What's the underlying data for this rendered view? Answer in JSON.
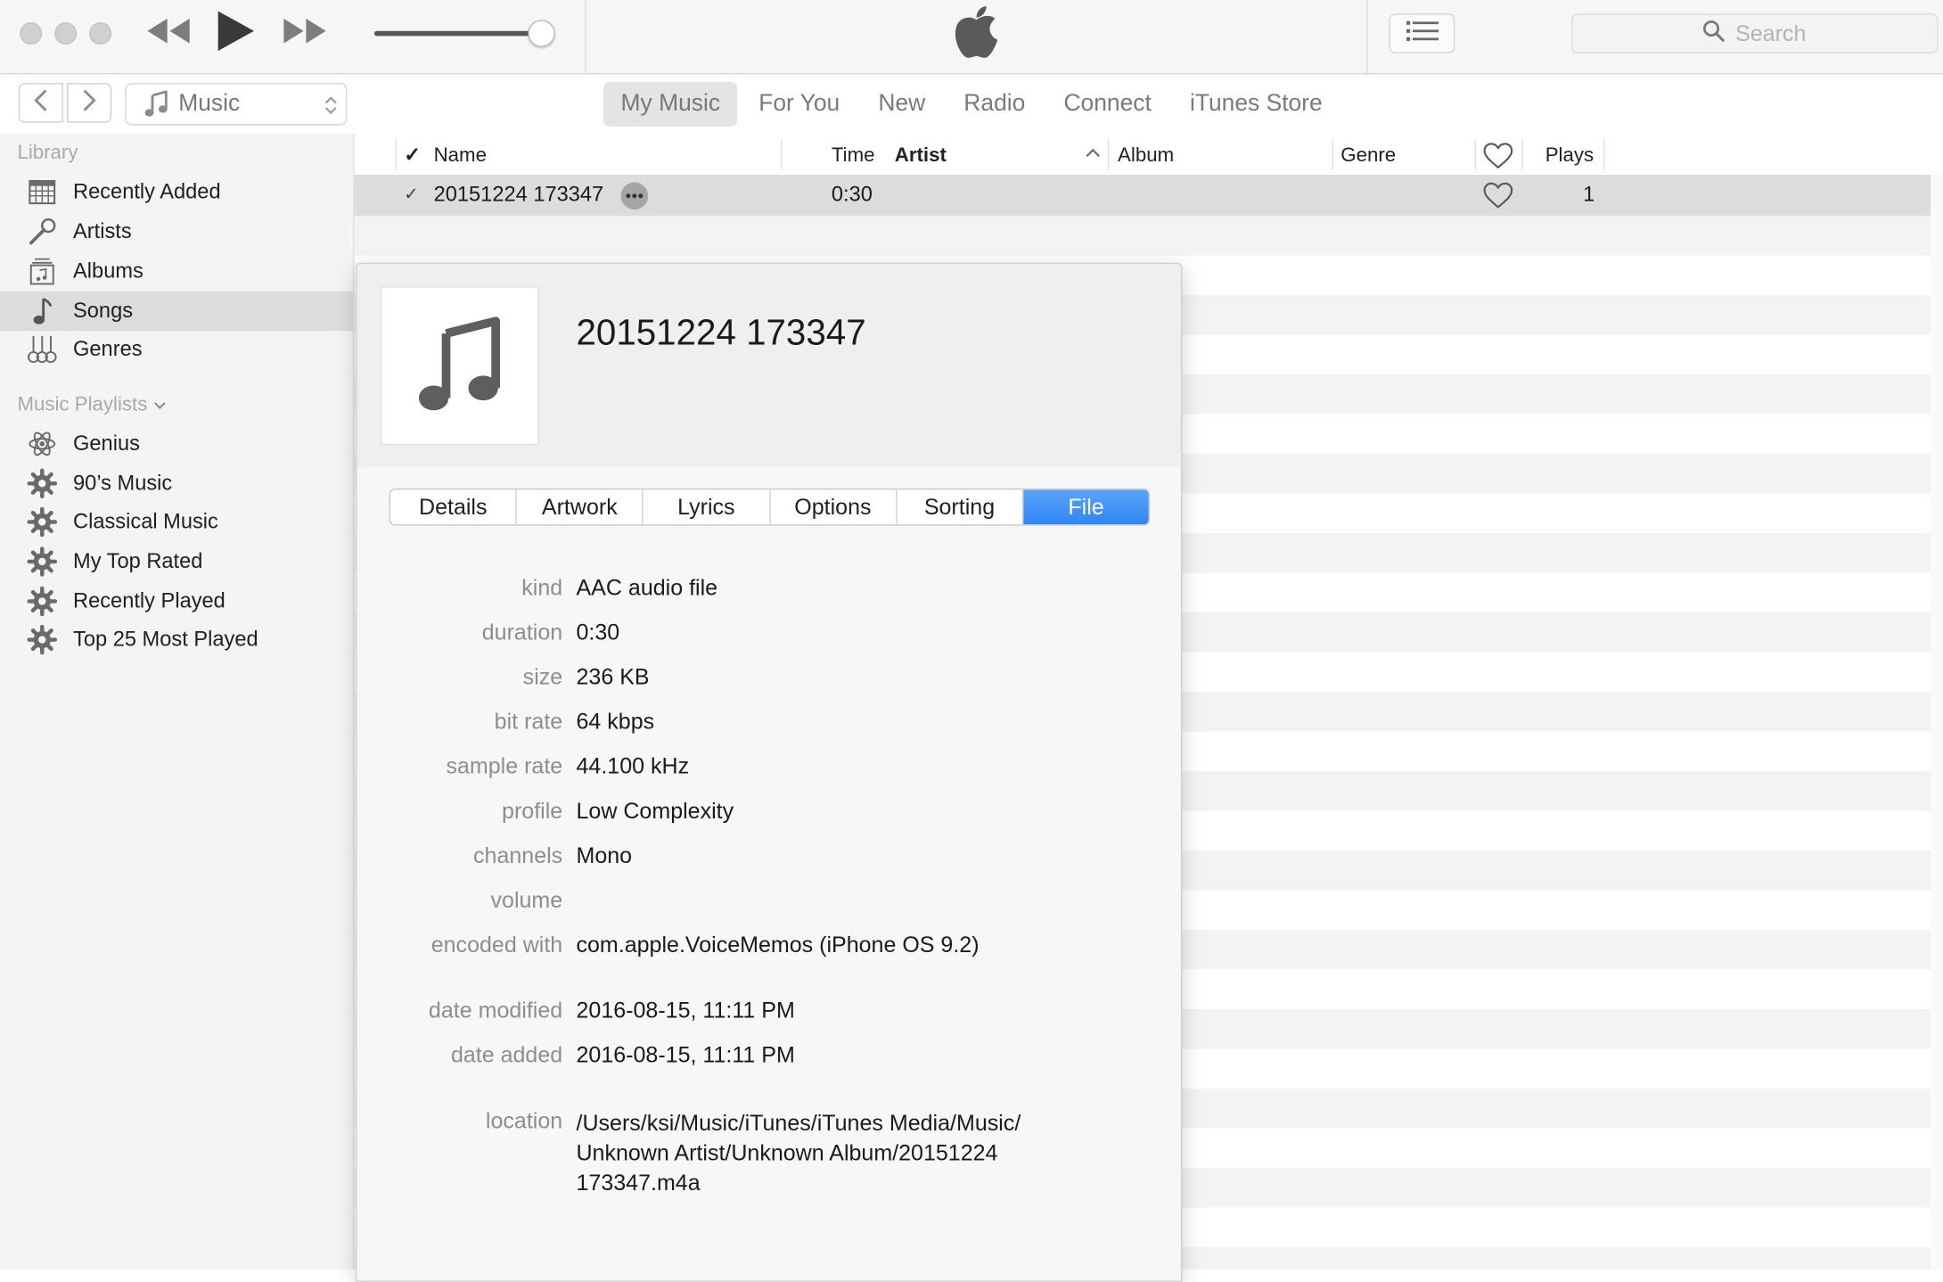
{
  "toolbar": {
    "search_placeholder": "Search"
  },
  "nav": {
    "media_picker": "Music",
    "tabs": [
      "My Music",
      "For You",
      "New",
      "Radio",
      "Connect",
      "iTunes Store"
    ]
  },
  "sidebar": {
    "library_heading": "Library",
    "library_items": [
      "Recently Added",
      "Artists",
      "Albums",
      "Songs",
      "Genres"
    ],
    "playlists_heading": "Music Playlists",
    "playlists": [
      "Genius",
      "90’s Music",
      "Classical Music",
      "My Top Rated",
      "Recently Played",
      "Top 25 Most Played"
    ]
  },
  "table": {
    "columns": {
      "check": "✓",
      "name": "Name",
      "time": "Time",
      "artist": "Artist",
      "album": "Album",
      "genre": "Genre",
      "plays": "Plays"
    },
    "rows": [
      {
        "check": "✓",
        "name": "20151224 173347",
        "time": "0:30",
        "artist": "",
        "album": "",
        "genre": "",
        "plays": "1"
      }
    ]
  },
  "info": {
    "title": "20151224 173347",
    "tabs": [
      "Details",
      "Artwork",
      "Lyrics",
      "Options",
      "Sorting",
      "File"
    ],
    "active_tab": "File",
    "fields": {
      "kind": {
        "label": "kind",
        "value": "AAC audio file"
      },
      "duration": {
        "label": "duration",
        "value": "0:30"
      },
      "size": {
        "label": "size",
        "value": "236 KB"
      },
      "bit_rate": {
        "label": "bit rate",
        "value": "64 kbps"
      },
      "sample_rate": {
        "label": "sample rate",
        "value": "44.100 kHz"
      },
      "profile": {
        "label": "profile",
        "value": "Low Complexity"
      },
      "channels": {
        "label": "channels",
        "value": "Mono"
      },
      "volume": {
        "label": "volume",
        "value": ""
      },
      "encoded_with": {
        "label": "encoded with",
        "value": "com.apple.VoiceMemos (iPhone OS 9.2)"
      },
      "date_modified": {
        "label": "date modified",
        "value": "2016-08-15, 11:11 PM"
      },
      "date_added": {
        "label": "date added",
        "value": "2016-08-15, 11:11 PM"
      },
      "location": {
        "label": "location",
        "value": "/Users/ksi/Music/iTunes/iTunes Media/Music/ Unknown Artist/Unknown Album/20151224 173347.m4a"
      }
    }
  },
  "colors": {
    "accent": "#2f86f4",
    "selection": "#dcdcdc",
    "sidebar_bg": "#f4f4f4"
  }
}
